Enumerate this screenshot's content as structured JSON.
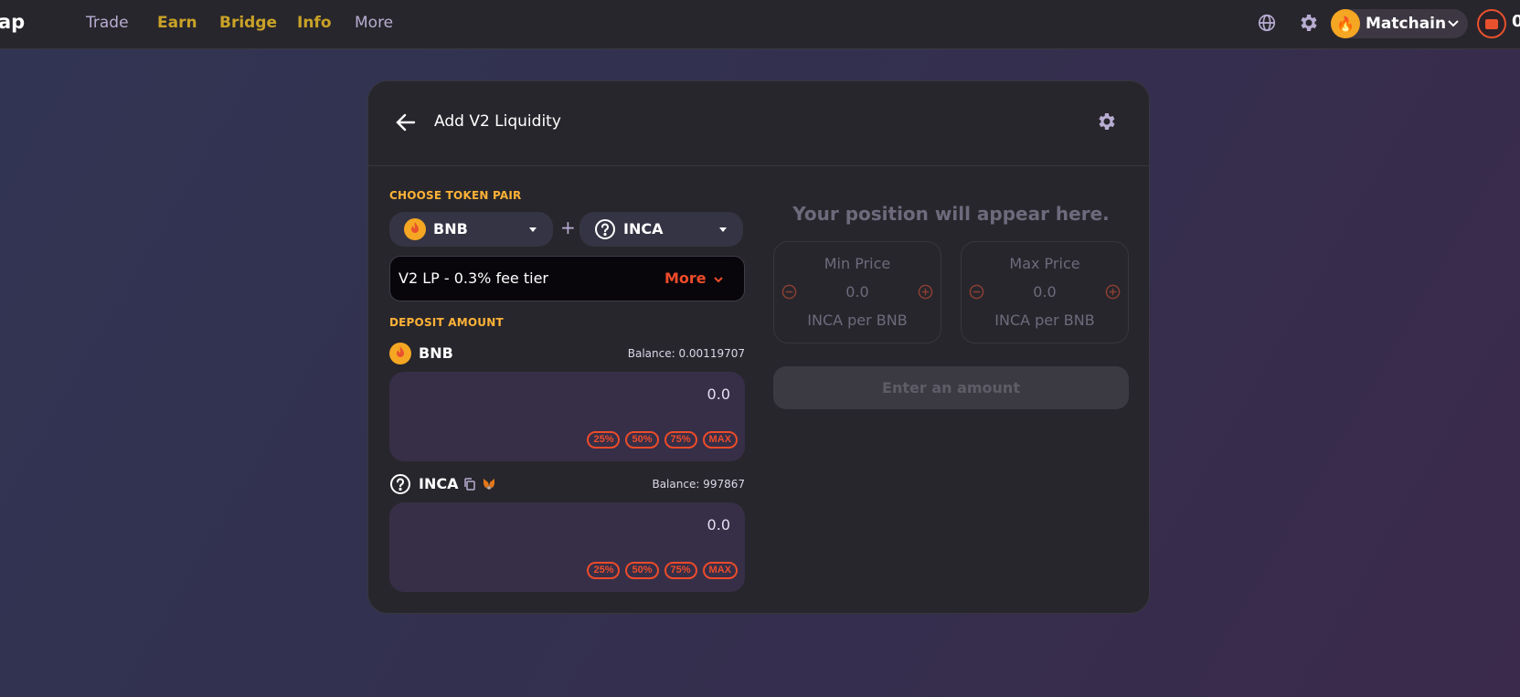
{
  "nav": {
    "logo_text": "ap",
    "items": [
      {
        "label": "Trade"
      },
      {
        "label": "Earn"
      },
      {
        "label": "Bridge"
      },
      {
        "label": "Info"
      },
      {
        "label": "More"
      }
    ],
    "chain_name": "Matchain",
    "wallet_text": "0"
  },
  "card": {
    "title": "Add V2 Liquidity",
    "choose_pair_label": "CHOOSE TOKEN PAIR",
    "token_a": "BNB",
    "plus": "+",
    "token_b": "INCA",
    "fee_tier_text": "V2 LP - 0.3% fee tier",
    "fee_more_label": "More",
    "deposit_label": "DEPOSIT AMOUNT",
    "deposit_a": {
      "name": "BNB",
      "balance": "Balance: 0.00119707",
      "amount": "0.0",
      "pcts": [
        "25%",
        "50%",
        "75%",
        "MAX"
      ]
    },
    "deposit_b": {
      "name": "INCA",
      "balance": "Balance: 997867",
      "amount": "0.0",
      "pcts": [
        "25%",
        "50%",
        "75%",
        "MAX"
      ]
    },
    "position_text": "Your position will appear here.",
    "min_price": {
      "title": "Min Price",
      "value": "0.0",
      "unit": "INCA per BNB"
    },
    "max_price": {
      "title": "Max Price",
      "value": "0.0",
      "unit": "INCA per BNB"
    },
    "enter_button": "Enter an amount"
  },
  "colors": {
    "accent": "#ed4b2a",
    "gold": "#ffb237"
  }
}
